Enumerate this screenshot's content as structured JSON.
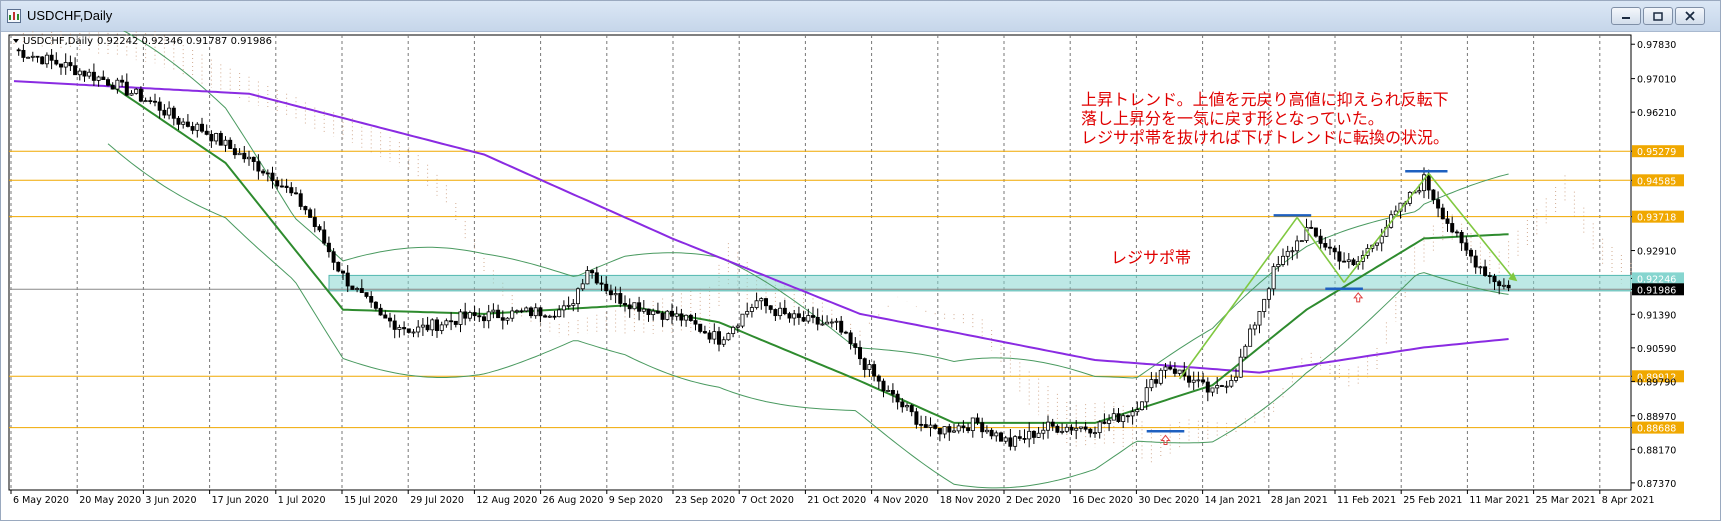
{
  "window": {
    "title": "USDCHF,Daily"
  },
  "chart_header": {
    "symbol": "USDCHF,Daily",
    "ohlc": "0.92242 0.92346 0.91787 0.91986"
  },
  "annotation": {
    "lines": [
      "上昇トレンド。上値を元戻り高値に抑えられ反転下",
      "落し上昇分を一気に戻す形となっていた。",
      "レジサポ帯を抜ければ下げトレンドに転換の状況。"
    ],
    "zone_label": "レジサポ帯"
  },
  "colors": {
    "annotation_text": "#e00000",
    "price_line": "#f0a800",
    "price_label_bg": "#f0a800",
    "zone_fill": "#86d5cf",
    "ma_purple": "#8a2be2",
    "ma_green": "#2e8b2e",
    "bollinger": "#4a9a60",
    "cloud": "#c89878",
    "trend_arrow": "#80c840",
    "marker_bar": "#1e60c0",
    "up_arrow": "#e04040"
  },
  "chart_data": {
    "type": "candlestick",
    "symbol": "USDCHF",
    "timeframe": "Daily",
    "last_ohlc": {
      "open": 0.92242,
      "high": 0.92346,
      "low": 0.91787,
      "close": 0.91986
    },
    "y_ticks": [
      "0.97830",
      "0.97010",
      "0.96210",
      "0.95279",
      "0.94585",
      "0.93718",
      "0.92910",
      "0.92246",
      "0.91986",
      "0.91390",
      "0.90590",
      "0.89912",
      "0.89790",
      "0.88970",
      "0.88688",
      "0.88170",
      "0.87370"
    ],
    "horizontal_levels": [
      0.95279,
      0.94585,
      0.93718,
      0.89912,
      0.88688
    ],
    "current_price": 0.91986,
    "zone": {
      "top": 0.92246,
      "bottom": 0.9202,
      "label": "レジサポ帯"
    },
    "x_labels": [
      "6 May 2020",
      "20 May 2020",
      "3 Jun 2020",
      "17 Jun 2020",
      "1 Jul 2020",
      "15 Jul 2020",
      "29 Jul 2020",
      "12 Aug 2020",
      "26 Aug 2020",
      "9 Sep 2020",
      "23 Sep 2020",
      "7 Oct 2020",
      "21 Oct 2020",
      "4 Nov 2020",
      "18 Nov 2020",
      "2 Dec 2020",
      "16 Dec 2020",
      "30 Dec 2020",
      "14 Jan 2021",
      "28 Jan 2021",
      "11 Feb 2021",
      "25 Feb 2021",
      "11 Mar 2021",
      "25 Mar 2021",
      "8 Apr 2021"
    ],
    "price_path": [
      [
        0,
        0.977
      ],
      [
        10,
        0.9735
      ],
      [
        20,
        0.9695
      ],
      [
        30,
        0.964
      ],
      [
        35,
        0.96
      ],
      [
        40,
        0.958
      ],
      [
        48,
        0.952
      ],
      [
        55,
        0.947
      ],
      [
        62,
        0.939
      ],
      [
        70,
        0.923
      ],
      [
        78,
        0.913
      ],
      [
        85,
        0.91
      ],
      [
        95,
        0.913
      ],
      [
        105,
        0.914
      ],
      [
        118,
        0.915
      ],
      [
        122,
        0.925
      ],
      [
        128,
        0.918
      ],
      [
        135,
        0.915
      ],
      [
        142,
        0.913
      ],
      [
        150,
        0.908
      ],
      [
        158,
        0.917
      ],
      [
        165,
        0.913
      ],
      [
        175,
        0.911
      ],
      [
        185,
        0.896
      ],
      [
        195,
        0.886
      ],
      [
        205,
        0.888
      ],
      [
        212,
        0.883
      ],
      [
        220,
        0.887
      ],
      [
        230,
        0.887
      ],
      [
        238,
        0.891
      ],
      [
        245,
        0.902
      ],
      [
        255,
        0.895
      ],
      [
        260,
        0.9
      ],
      [
        268,
        0.924
      ],
      [
        275,
        0.934
      ],
      [
        285,
        0.925
      ],
      [
        292,
        0.935
      ],
      [
        300,
        0.946
      ],
      [
        308,
        0.93
      ],
      [
        314,
        0.923
      ],
      [
        318,
        0.92
      ]
    ],
    "ma_purple_path": [
      [
        0,
        0.9695
      ],
      [
        50,
        0.9665
      ],
      [
        100,
        0.952
      ],
      [
        140,
        0.932
      ],
      [
        180,
        0.914
      ],
      [
        230,
        0.903
      ],
      [
        265,
        0.9
      ],
      [
        300,
        0.906
      ],
      [
        318,
        0.908
      ]
    ],
    "ma_green_path": [
      [
        20,
        0.969
      ],
      [
        45,
        0.95
      ],
      [
        70,
        0.915
      ],
      [
        100,
        0.914
      ],
      [
        130,
        0.916
      ],
      [
        150,
        0.912
      ],
      [
        180,
        0.898
      ],
      [
        200,
        0.888
      ],
      [
        230,
        0.888
      ],
      [
        255,
        0.897
      ],
      [
        275,
        0.915
      ],
      [
        300,
        0.932
      ],
      [
        318,
        0.933
      ]
    ]
  }
}
